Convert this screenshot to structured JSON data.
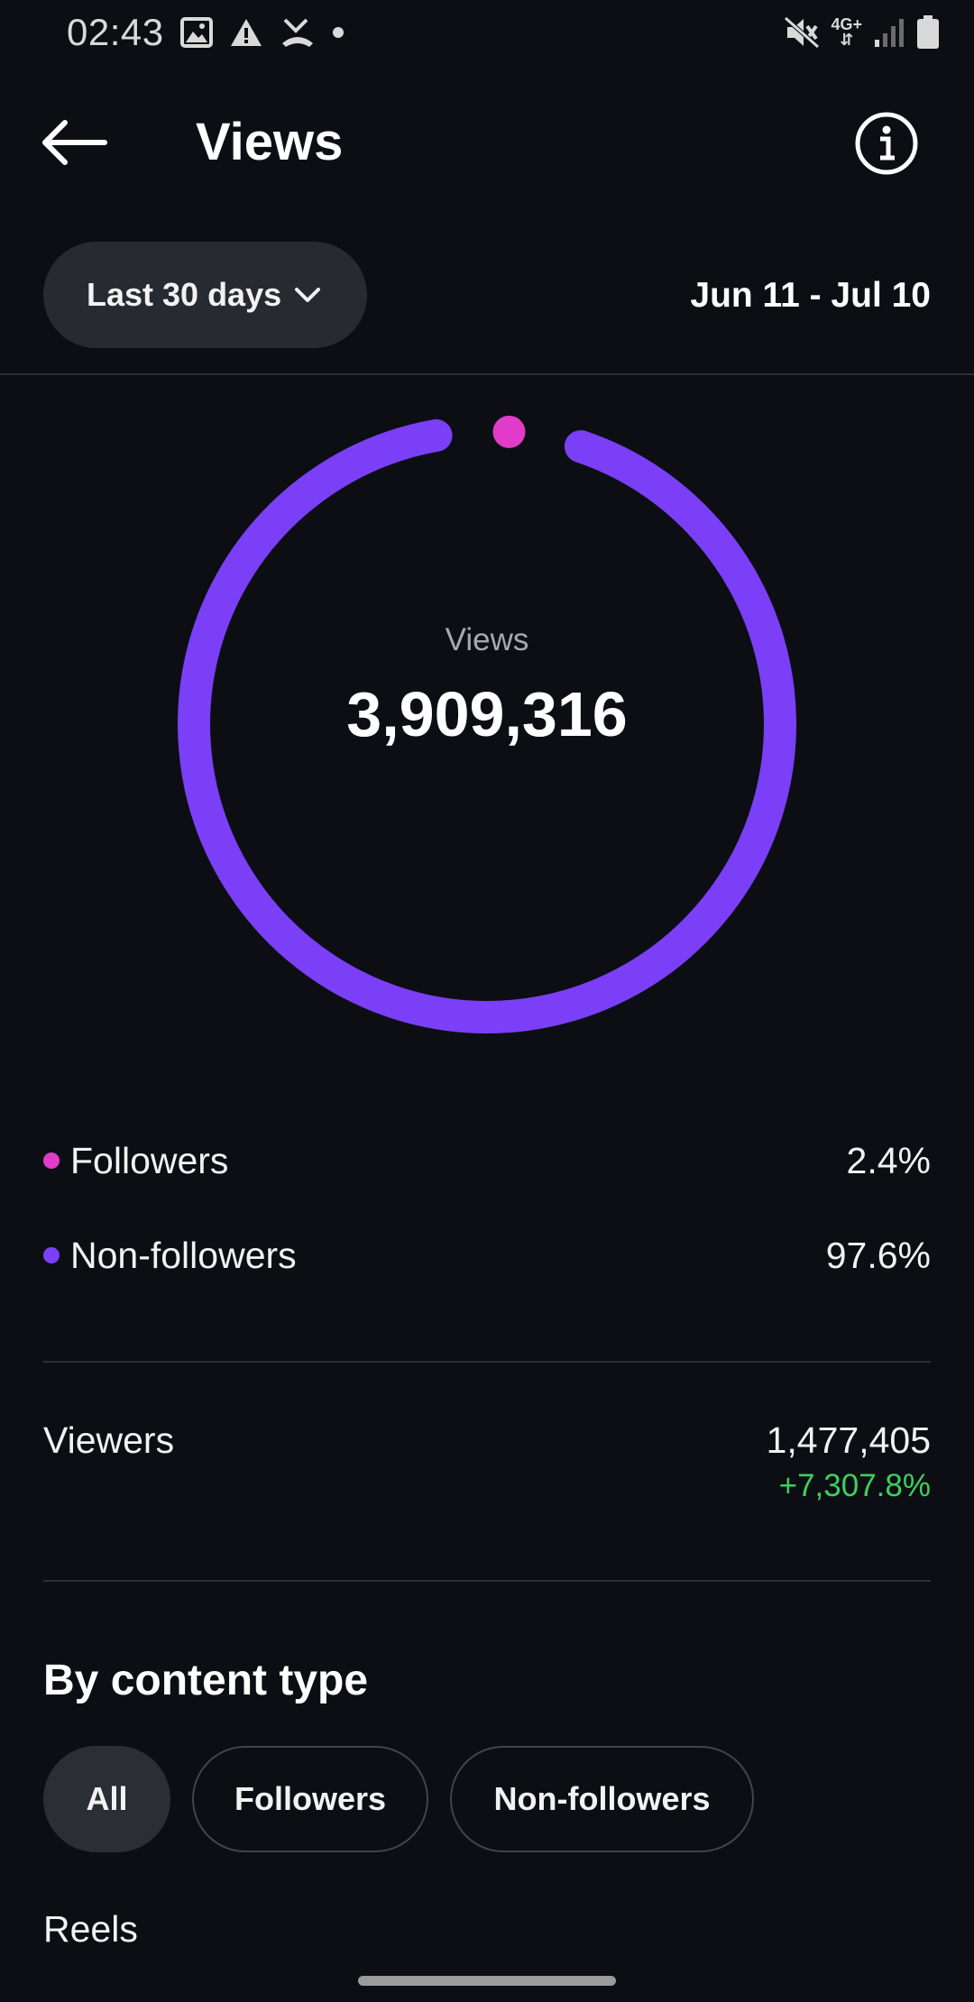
{
  "status_bar": {
    "time": "02:43",
    "network": "4G+"
  },
  "header": {
    "title": "Views"
  },
  "filter": {
    "range_label": "Last 30 days",
    "date_range": "Jun 11 - Jul 10"
  },
  "chart_data": {
    "type": "pie",
    "title": "Views",
    "total": "3,909,316",
    "slices": [
      {
        "label": "Followers",
        "value": 2.4,
        "color": "#e03cc9"
      },
      {
        "label": "Non-followers",
        "value": 97.6,
        "color": "#7b3ff7"
      }
    ]
  },
  "legend": [
    {
      "label": "Followers",
      "value": "2.4%",
      "color": "#e03cc9"
    },
    {
      "label": "Non-followers",
      "value": "97.6%",
      "color": "#7b3ff7"
    }
  ],
  "viewers": {
    "label": "Viewers",
    "value": "1,477,405",
    "change": "+7,307.8%"
  },
  "content_type": {
    "title": "By content type",
    "chips": [
      {
        "label": "All",
        "active": true
      },
      {
        "label": "Followers",
        "active": false
      },
      {
        "label": "Non-followers",
        "active": false
      }
    ],
    "first_section": "Reels"
  },
  "icons": {
    "back": "arrow-left-icon",
    "info": "info-icon",
    "dropdown": "chevron-down-icon"
  }
}
